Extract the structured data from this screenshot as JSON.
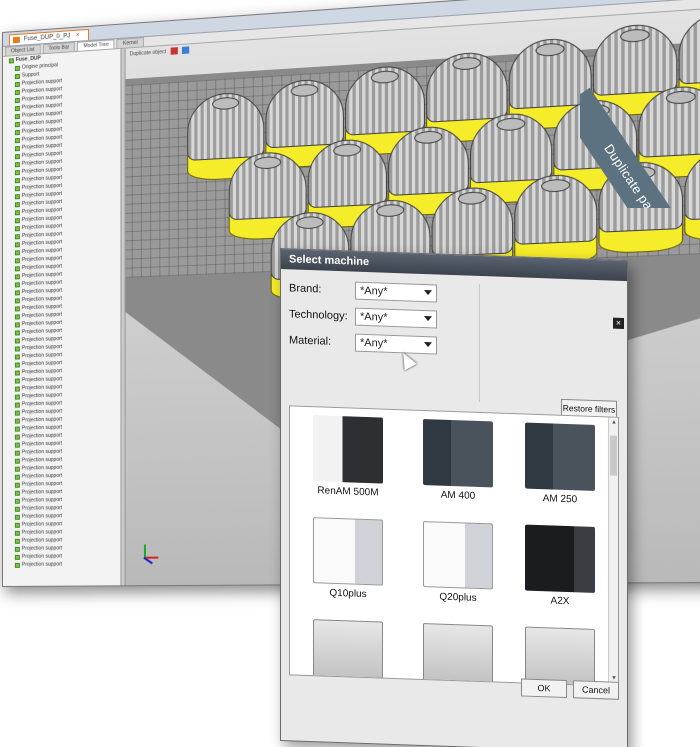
{
  "app": {
    "tab_title": "Fuse_DUP_0_PJ",
    "panel_tabs": [
      "Object List",
      "Tools Bar",
      "Model Tree",
      "Kernel"
    ],
    "active_panel_tab": 2,
    "viewport_label": "Duplicate object"
  },
  "tree": {
    "root_label": "Fuse_DUP",
    "rows": [
      "Origine principal",
      "Support",
      "Projection support",
      "Projection support",
      "Projection support",
      "Projection support",
      "Projection support",
      "Projection support",
      "Projection support",
      "Projection support",
      "Projection support",
      "Projection support",
      "Projection support",
      "Projection support",
      "Projection support",
      "Projection support",
      "Projection support",
      "Projection support",
      "Projection support",
      "Projection support",
      "Projection support",
      "Projection support",
      "Projection support",
      "Projection support",
      "Projection support",
      "Projection support",
      "Projection support",
      "Projection support",
      "Projection support",
      "Projection support",
      "Projection support",
      "Projection support",
      "Projection support",
      "Projection support",
      "Projection support",
      "Projection support",
      "Projection support",
      "Projection support",
      "Projection support",
      "Projection support",
      "Projection support",
      "Projection support",
      "Projection support",
      "Projection support",
      "Projection support",
      "Projection support",
      "Projection support",
      "Projection support",
      "Projection support",
      "Projection support",
      "Projection support",
      "Projection support",
      "Projection support",
      "Projection support",
      "Projection support",
      "Projection support",
      "Projection support",
      "Projection support",
      "Projection support",
      "Projection support",
      "Projection support",
      "Projection support",
      "Projection support"
    ]
  },
  "banner": {
    "text": "Duplicate part"
  },
  "dialog": {
    "title": "Select machine",
    "close_glyph": "×",
    "filters": [
      {
        "label": "Brand:",
        "value": "*Any*"
      },
      {
        "label": "Technology:",
        "value": "*Any*"
      },
      {
        "label": "Material:",
        "value": "*Any*"
      }
    ],
    "restore_filters": "Restore filters",
    "machines": [
      {
        "name": "RenAM 500M",
        "style": "m-renam"
      },
      {
        "name": "AM 400",
        "style": "m-dark"
      },
      {
        "name": "AM 250",
        "style": "m-dark"
      },
      {
        "name": "Q10plus",
        "style": "m-white"
      },
      {
        "name": "Q20plus",
        "style": "m-white"
      },
      {
        "name": "A2X",
        "style": "m-a2x"
      },
      {
        "name": "",
        "style": "m-tall"
      },
      {
        "name": "",
        "style": "m-tall"
      },
      {
        "name": "",
        "style": "m-tall"
      }
    ],
    "ok": "OK",
    "cancel": "Cancel"
  },
  "colors": {
    "support_yellow": "#f5ec2a",
    "tree_check_green": "#7ec246",
    "tab_accent_orange": "#e57c1e",
    "banner_slate": "#5d7281"
  }
}
